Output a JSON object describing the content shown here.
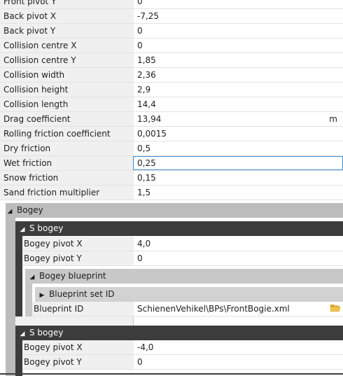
{
  "top_rows": [
    {
      "label": "Front pivot Y",
      "value": "0"
    },
    {
      "label": "Back pivot X",
      "value": "-7,25"
    },
    {
      "label": "Back pivot Y",
      "value": "0"
    },
    {
      "label": "Collision centre X",
      "value": "0"
    },
    {
      "label": "Collision centre Y",
      "value": "1,85"
    },
    {
      "label": "Collision width",
      "value": "2,36"
    },
    {
      "label": "Collision height",
      "value": "2,9"
    },
    {
      "label": "Collision length",
      "value": "14,4"
    },
    {
      "label": "Drag coefficient",
      "value": "13,94",
      "unit": "m"
    },
    {
      "label": "Rolling friction coefficient",
      "value": "0,0015"
    },
    {
      "label": "Dry friction",
      "value": "0,5"
    },
    {
      "label": "Wet friction",
      "value": "0,25",
      "selected": true
    },
    {
      "label": "Snow friction",
      "value": "0,15"
    },
    {
      "label": "Sand friction multiplier",
      "value": "1,5"
    }
  ],
  "bogey_group": {
    "label": "Bogey",
    "s_bogey_1": {
      "label": "S bogey",
      "pivot_x": {
        "label": "Bogey pivot X",
        "value": "4,0"
      },
      "pivot_y": {
        "label": "Bogey pivot Y",
        "value": "0"
      },
      "blueprint": {
        "label": "Bogey blueprint",
        "set_id_label": "Blueprint set ID",
        "id_label": "Blueprint ID",
        "id_value": "SchienenVehikel\\BPs\\FrontBogie.xml",
        "browse_icon": "folder-open-icon"
      }
    },
    "s_bogey_2": {
      "label": "S bogey",
      "pivot_x": {
        "label": "Bogey pivot X",
        "value": "-4,0"
      },
      "pivot_y": {
        "label": "Bogey pivot Y",
        "value": "0"
      }
    }
  }
}
